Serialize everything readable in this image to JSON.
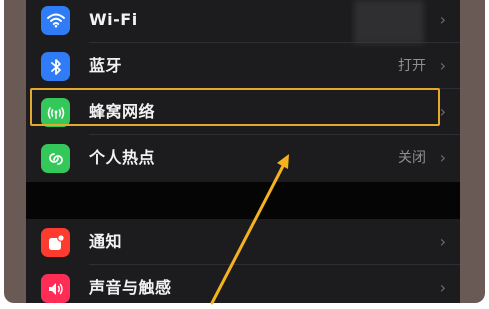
{
  "settings": {
    "items": [
      {
        "label": "Wi-Fi",
        "value": "",
        "icon": "wifi-icon",
        "color": "#2f7cf6"
      },
      {
        "label": "蓝牙",
        "value": "打开",
        "icon": "bluetooth-icon",
        "color": "#2f7cf6"
      },
      {
        "label": "蜂窝网络",
        "value": "",
        "icon": "cellular-icon",
        "color": "#34c759"
      },
      {
        "label": "个人热点",
        "value": "关闭",
        "icon": "hotspot-icon",
        "color": "#34c759"
      },
      {
        "label": "通知",
        "value": "",
        "icon": "notifications-icon",
        "color": "#ff3b30"
      },
      {
        "label": "声音与触感",
        "value": "",
        "icon": "sounds-icon",
        "color": "#ff2d55"
      }
    ]
  },
  "annotation": {
    "highlight_color": "#e3a92d",
    "arrow_color": "#f4b21e",
    "highlighted_item": "蜂窝网络"
  }
}
